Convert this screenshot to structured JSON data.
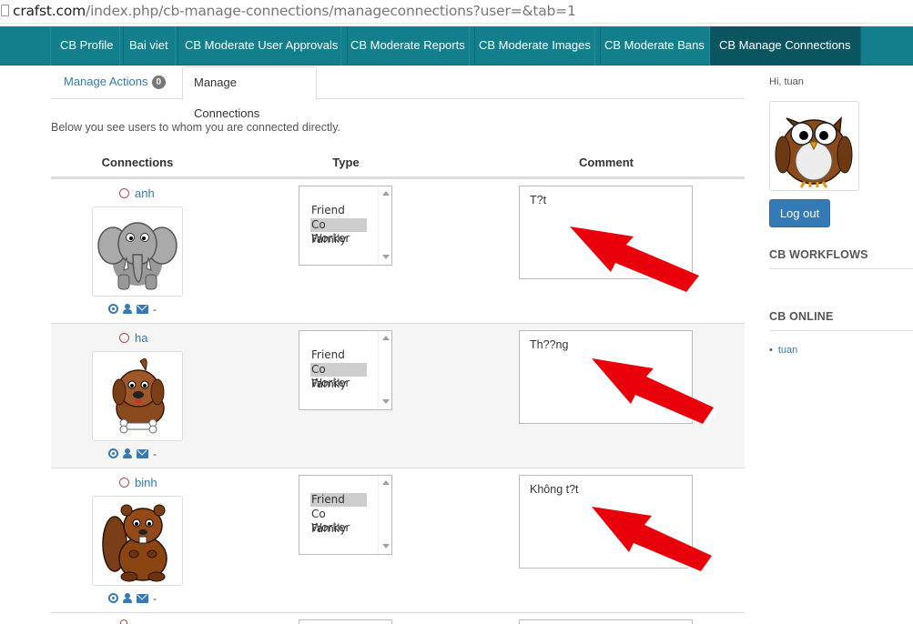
{
  "browser": {
    "url_host": "crafst.com",
    "url_path": "/index.php/cb-manage-connections/manageconnections?user=&tab=1"
  },
  "nav": {
    "items": [
      {
        "label": "CB Profile"
      },
      {
        "label": "Bai viet"
      },
      {
        "label": "CB Moderate User Approvals"
      },
      {
        "label": "CB Moderate Reports"
      },
      {
        "label": "CB Moderate Images"
      },
      {
        "label": "CB Moderate Bans"
      },
      {
        "label": "CB Manage Connections"
      }
    ],
    "active": "CB Manage Connections"
  },
  "tabs": {
    "manage_actions": {
      "label": "Manage Actions",
      "badge": "0"
    },
    "manage_connections": {
      "label": "Manage Connections"
    }
  },
  "intro": "Below you see users to whom you are connected directly.",
  "table": {
    "headers": {
      "connections": "Connections",
      "type": "Type",
      "comment": "Comment"
    },
    "type_options": [
      "Friend",
      "Co Worker",
      "Family"
    ],
    "rows": [
      {
        "name": "anh",
        "selected_type": "Co Worker",
        "comment": "T?t",
        "avatar": "elephant-avatar",
        "action_separator": "-"
      },
      {
        "name": "ha",
        "selected_type": "Co Worker",
        "comment": "Th??ng",
        "avatar": "dog-avatar",
        "action_separator": "-"
      },
      {
        "name": "binh",
        "selected_type": "Friend",
        "comment": "Không t?t",
        "avatar": "beaver-avatar",
        "action_separator": "-"
      }
    ]
  },
  "sidebar": {
    "greeting": "Hi, tuan",
    "avatar": "owl-avatar",
    "logout_label": "Log out",
    "workflows_title": "CB WORKFLOWS",
    "online_title": "CB ONLINE",
    "online_users": [
      "tuan"
    ]
  },
  "colors": {
    "nav_bg": "#137f8c",
    "nav_active": "#0a5560",
    "link": "#337ab7",
    "button": "#337ab7",
    "annotation_arrow": "#e8000b"
  },
  "icons": [
    "page-icon",
    "status-ring-icon",
    "connection-icon",
    "profile-icon",
    "mail-icon",
    "scroll-up-icon",
    "scroll-down-icon",
    "red-arrow-annotation"
  ]
}
